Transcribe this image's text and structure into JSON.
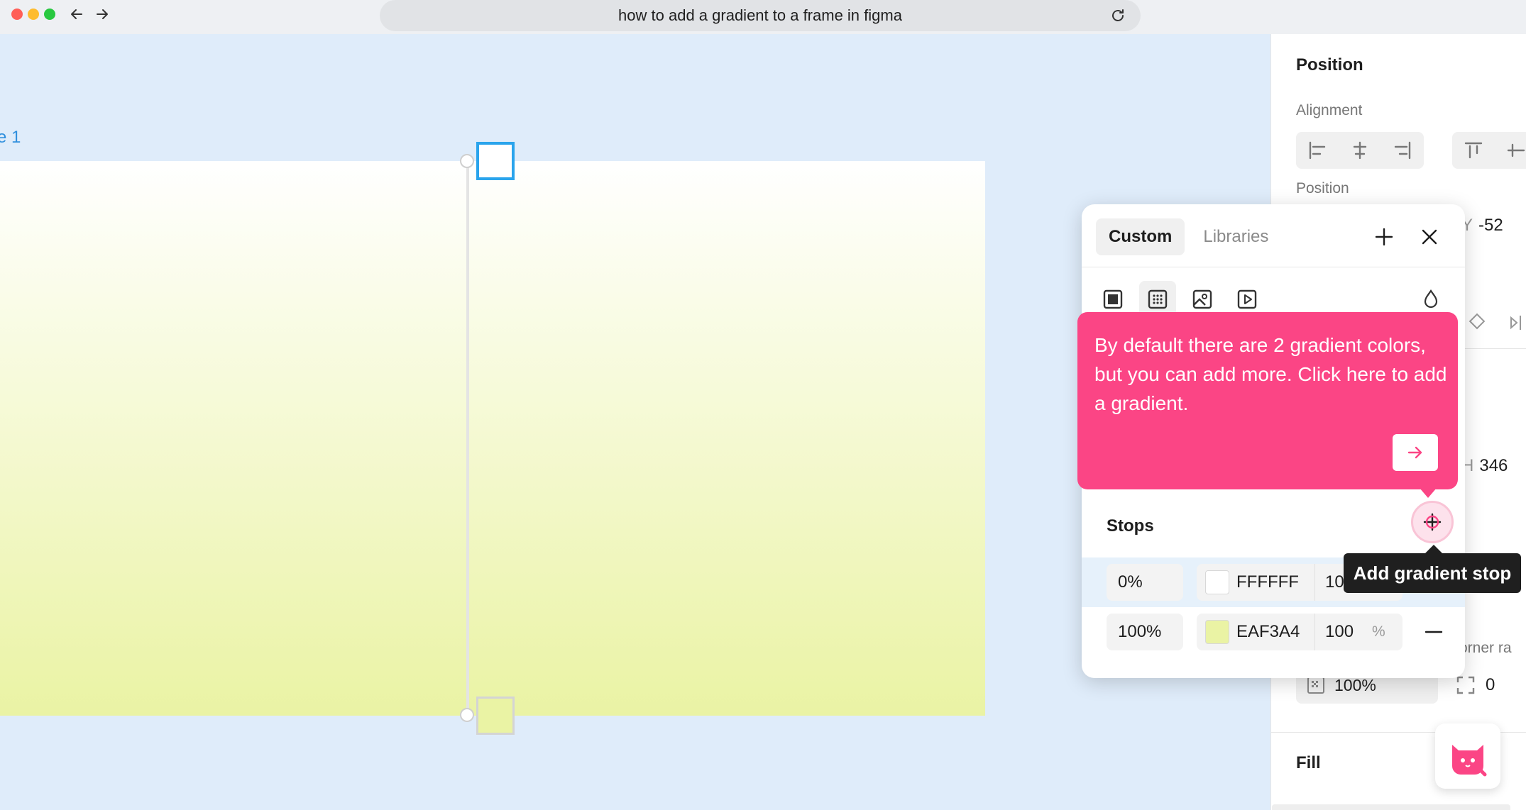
{
  "browser": {
    "url_text": "how to add a gradient to a frame in figma"
  },
  "canvas": {
    "frame_label": "e 1",
    "gradient_colors": [
      "#FFFFFF",
      "#EAF3A4"
    ]
  },
  "right_panel": {
    "position_title": "Position",
    "alignment_label": "Alignment",
    "position_label": "Position",
    "y_label": "Y",
    "y_value": "-52",
    "h_label": "H",
    "h_value": "346",
    "corner_label": "orner ra",
    "opacity_value": "100%",
    "corner_value": "0",
    "fill_title": "Fill"
  },
  "picker": {
    "tab_custom": "Custom",
    "tab_libraries": "Libraries",
    "stops_title": "Stops",
    "stops": [
      {
        "position": "0%",
        "hex": "FFFFFF",
        "opacity": "10",
        "color": "#FFFFFF"
      },
      {
        "position": "100%",
        "hex": "EAF3A4",
        "opacity": "100",
        "unit": "%",
        "color": "#EAF3A4"
      }
    ]
  },
  "guide": {
    "text": "By default there are 2 gradient colors, but you can add more. Click here to add a gradient.",
    "accent": "#FB4585"
  },
  "tooltip": {
    "text": "Add gradient stop"
  }
}
